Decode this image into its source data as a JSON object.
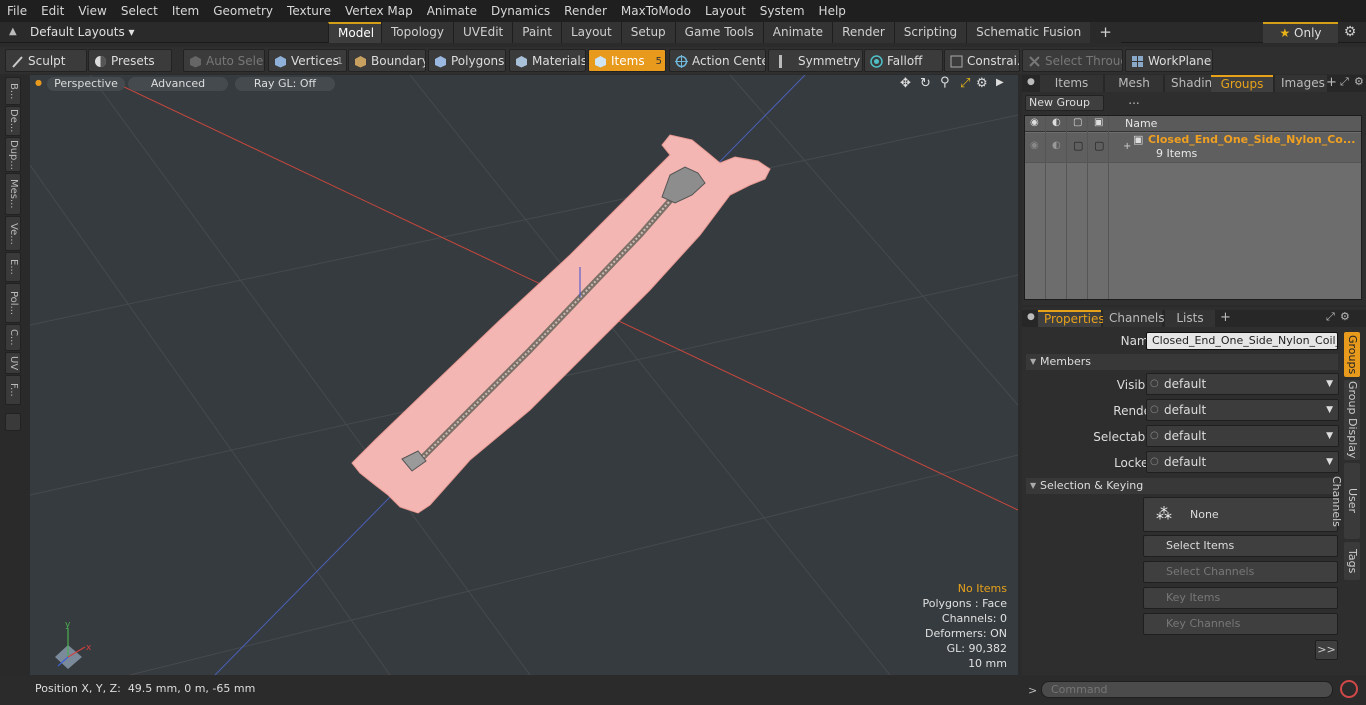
{
  "menubar": {
    "items": [
      "File",
      "Edit",
      "View",
      "Select",
      "Item",
      "Geometry",
      "Texture",
      "Vertex Map",
      "Animate",
      "Dynamics",
      "Render",
      "MaxToModo",
      "Layout",
      "System",
      "Help"
    ]
  },
  "modebar": {
    "layout_label": "Default Layouts",
    "tabs": [
      "Model",
      "Topology",
      "UVEdit",
      "Paint",
      "Layout",
      "Setup",
      "Game Tools",
      "Animate",
      "Render",
      "Scripting",
      "Schematic Fusion"
    ],
    "active_tab": "Model",
    "only_label": "Only"
  },
  "toolbar": {
    "sculpt": "Sculpt",
    "presets": "Presets",
    "auto_select": "Auto Select",
    "vertices": "Vertices",
    "vertices_count": "1",
    "boundary": "Boundary",
    "polygons": "Polygons",
    "materials": "Materials",
    "items": "Items",
    "items_count": "5",
    "action_center": "Action Center",
    "symmetry": "Symmetry",
    "falloff": "Falloff",
    "constraints": "Constrai...",
    "select_through": "Select Through",
    "workplane": "WorkPlane"
  },
  "left_tabs": [
    "B...",
    "De...",
    "Dup...",
    "Mes...",
    "Ve...",
    "E...",
    "Pol...",
    "C...",
    "UV",
    "F..."
  ],
  "viewport": {
    "view": "Perspective",
    "shading": "Advanced",
    "raygl": "Ray GL: Off",
    "info": {
      "selection": "No Items",
      "polygons": "Polygons : Face",
      "channels": "Channels: 0",
      "deformers": "Deformers: ON",
      "gl": "GL: 90,382",
      "scale": "10 mm"
    }
  },
  "status": {
    "position_label": "Position X, Y, Z:",
    "position_value": "49.5 mm, 0 m, -65 mm"
  },
  "right_top": {
    "tabs": [
      "Items",
      "Mesh ...",
      "Shading",
      "Groups",
      "Images"
    ],
    "active_tab": "Groups",
    "new_group": "New Group",
    "name_header": "Name",
    "group": {
      "name": "Closed_End_One_Side_Nylon_Co...",
      "count": "9 Items"
    }
  },
  "properties": {
    "tabs": [
      "Properties",
      "Channels",
      "Lists"
    ],
    "active_tab": "Properties",
    "name_label": "Name",
    "name_value": "Closed_End_One_Side_Nylon_Coil_Zip",
    "members_header": "Members",
    "rows": [
      {
        "label": "Visible",
        "value": "default"
      },
      {
        "label": "Render",
        "value": "default"
      },
      {
        "label": "Selectable",
        "value": "default"
      },
      {
        "label": "Locked",
        "value": "default"
      }
    ],
    "selection_header": "Selection & Keying",
    "none_label": "None",
    "buttons": [
      {
        "label": "Select Items",
        "enabled": true
      },
      {
        "label": "Select Channels",
        "enabled": false
      },
      {
        "label": "Key Items",
        "enabled": false
      },
      {
        "label": "Key Channels",
        "enabled": false
      }
    ],
    "more": ">>",
    "side_tabs": [
      "Groups",
      "Group Display",
      "User Channels",
      "Tags"
    ]
  },
  "command": {
    "prompt": ">",
    "placeholder": "Command"
  },
  "colors": {
    "accent": "#e89a1c",
    "zipper_fabric": "#f4b6b2",
    "viewport_bg": "#363b3f"
  }
}
